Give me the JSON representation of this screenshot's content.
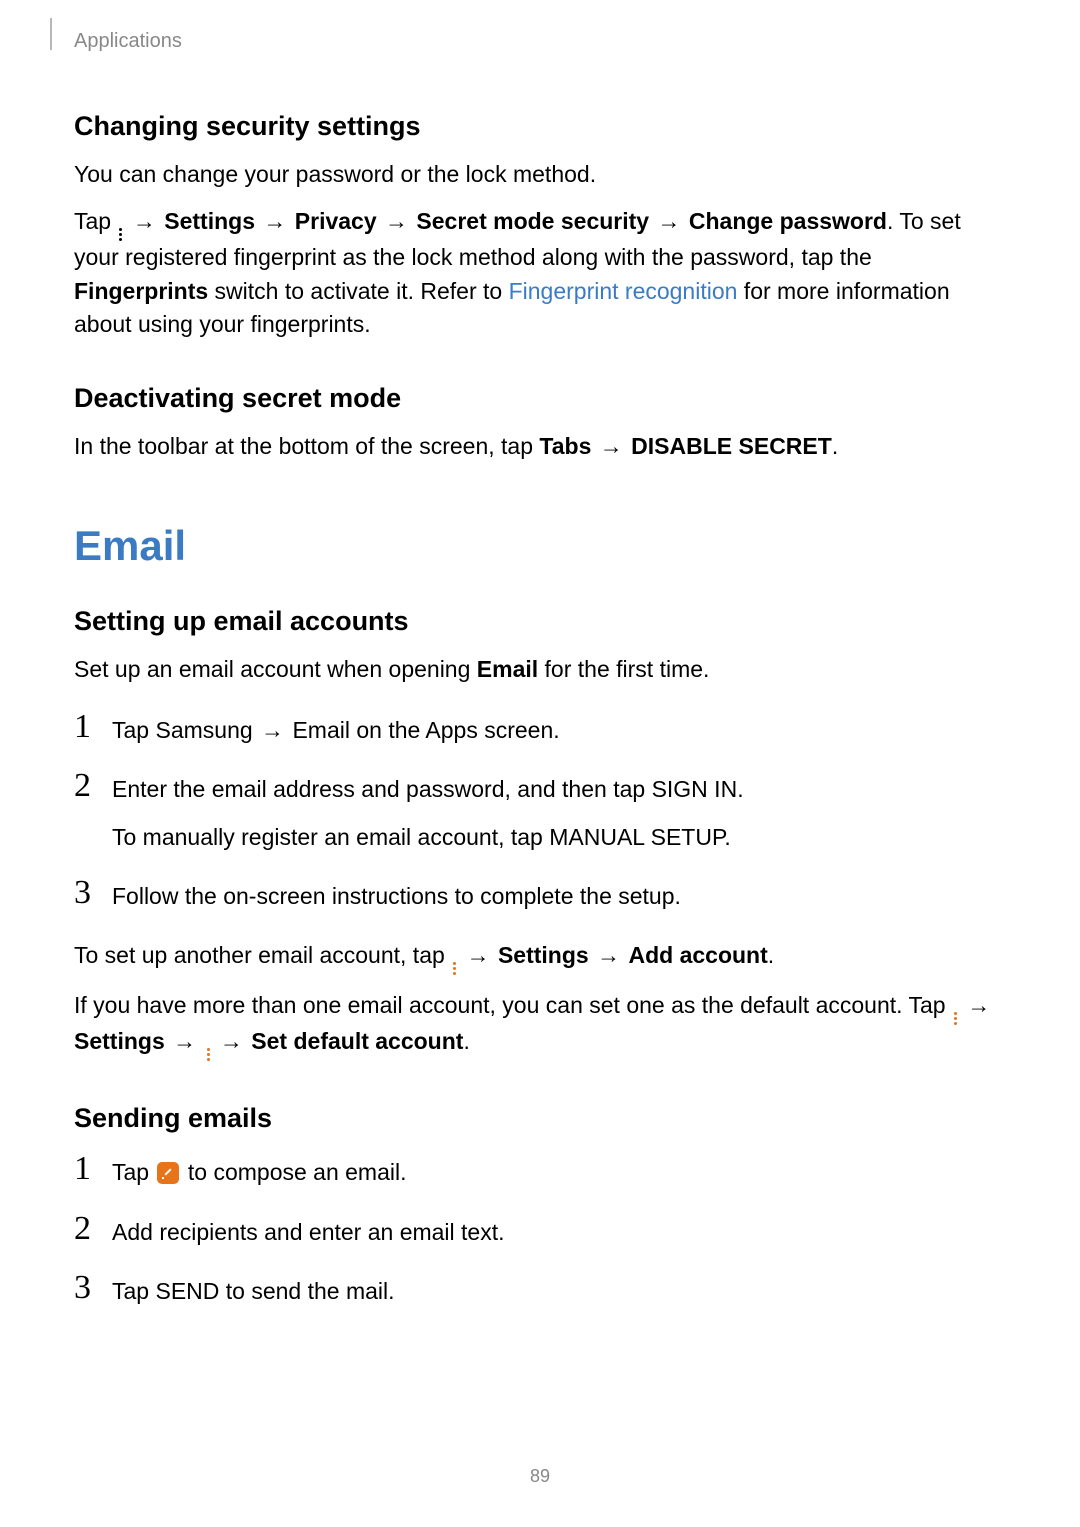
{
  "header": {
    "breadcrumb": "Applications"
  },
  "section1": {
    "title": "Changing security settings",
    "intro": "You can change your password or the lock method.",
    "tap_prefix": "Tap ",
    "path": {
      "settings": "Settings",
      "privacy": "Privacy",
      "secret_mode": "Secret mode security",
      "change_pw": "Change password"
    },
    "tap_suffix": ". To set your registered fingerprint as the lock method along with the password, tap the ",
    "fingerprints": "Fingerprints",
    "switch_text": " switch to activate it. Refer to ",
    "link": "Fingerprint recognition",
    "after_link": " for more information about using your fingerprints."
  },
  "section2": {
    "title": "Deactivating secret mode",
    "text_prefix": "In the toolbar at the bottom of the screen, tap ",
    "tabs": "Tabs",
    "disable": "DISABLE SECRET",
    "period": "."
  },
  "email": {
    "title": "Email"
  },
  "section3": {
    "title": "Setting up email accounts",
    "intro_prefix": "Set up an email account when opening ",
    "intro_bold": "Email",
    "intro_suffix": " for the first time.",
    "steps": {
      "s1": {
        "num": "1",
        "prefix": "Tap ",
        "samsung": "Samsung",
        "email": "Email",
        "suffix": " on the Apps screen."
      },
      "s2": {
        "num": "2",
        "prefix": "Enter the email address and password, and then tap ",
        "signin": "SIGN IN",
        "period": ".",
        "sub_prefix": "To manually register an email account, tap ",
        "manual": "MANUAL SETUP",
        "sub_period": "."
      },
      "s3": {
        "num": "3",
        "text": "Follow the on-screen instructions to complete the setup."
      }
    },
    "another_prefix": "To set up another email account, tap ",
    "another_settings": "Settings",
    "another_add": "Add account",
    "another_period": ".",
    "default_prefix": "If you have more than one email account, you can set one as the default account. Tap ",
    "default_settings": "Settings",
    "default_set": "Set default account",
    "default_period": "."
  },
  "section4": {
    "title": "Sending emails",
    "steps": {
      "s1": {
        "num": "1",
        "prefix": "Tap ",
        "suffix": " to compose an email."
      },
      "s2": {
        "num": "2",
        "text": "Add recipients and enter an email text."
      },
      "s3": {
        "num": "3",
        "prefix": "Tap ",
        "send": "SEND",
        "suffix": " to send the mail."
      }
    }
  },
  "page_number": "89"
}
